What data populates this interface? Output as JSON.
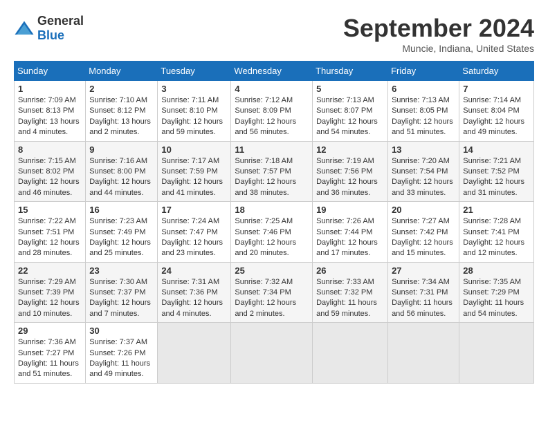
{
  "header": {
    "logo_general": "General",
    "logo_blue": "Blue",
    "title": "September 2024",
    "location": "Muncie, Indiana, United States"
  },
  "calendar": {
    "days_of_week": [
      "Sunday",
      "Monday",
      "Tuesday",
      "Wednesday",
      "Thursday",
      "Friday",
      "Saturday"
    ],
    "weeks": [
      [
        {
          "day": "1",
          "sunrise": "7:09 AM",
          "sunset": "8:13 PM",
          "daylight": "13 hours and 4 minutes."
        },
        {
          "day": "2",
          "sunrise": "7:10 AM",
          "sunset": "8:12 PM",
          "daylight": "13 hours and 2 minutes."
        },
        {
          "day": "3",
          "sunrise": "7:11 AM",
          "sunset": "8:10 PM",
          "daylight": "12 hours and 59 minutes."
        },
        {
          "day": "4",
          "sunrise": "7:12 AM",
          "sunset": "8:09 PM",
          "daylight": "12 hours and 56 minutes."
        },
        {
          "day": "5",
          "sunrise": "7:13 AM",
          "sunset": "8:07 PM",
          "daylight": "12 hours and 54 minutes."
        },
        {
          "day": "6",
          "sunrise": "7:13 AM",
          "sunset": "8:05 PM",
          "daylight": "12 hours and 51 minutes."
        },
        {
          "day": "7",
          "sunrise": "7:14 AM",
          "sunset": "8:04 PM",
          "daylight": "12 hours and 49 minutes."
        }
      ],
      [
        {
          "day": "8",
          "sunrise": "7:15 AM",
          "sunset": "8:02 PM",
          "daylight": "12 hours and 46 minutes."
        },
        {
          "day": "9",
          "sunrise": "7:16 AM",
          "sunset": "8:00 PM",
          "daylight": "12 hours and 44 minutes."
        },
        {
          "day": "10",
          "sunrise": "7:17 AM",
          "sunset": "7:59 PM",
          "daylight": "12 hours and 41 minutes."
        },
        {
          "day": "11",
          "sunrise": "7:18 AM",
          "sunset": "7:57 PM",
          "daylight": "12 hours and 38 minutes."
        },
        {
          "day": "12",
          "sunrise": "7:19 AM",
          "sunset": "7:56 PM",
          "daylight": "12 hours and 36 minutes."
        },
        {
          "day": "13",
          "sunrise": "7:20 AM",
          "sunset": "7:54 PM",
          "daylight": "12 hours and 33 minutes."
        },
        {
          "day": "14",
          "sunrise": "7:21 AM",
          "sunset": "7:52 PM",
          "daylight": "12 hours and 31 minutes."
        }
      ],
      [
        {
          "day": "15",
          "sunrise": "7:22 AM",
          "sunset": "7:51 PM",
          "daylight": "12 hours and 28 minutes."
        },
        {
          "day": "16",
          "sunrise": "7:23 AM",
          "sunset": "7:49 PM",
          "daylight": "12 hours and 25 minutes."
        },
        {
          "day": "17",
          "sunrise": "7:24 AM",
          "sunset": "7:47 PM",
          "daylight": "12 hours and 23 minutes."
        },
        {
          "day": "18",
          "sunrise": "7:25 AM",
          "sunset": "7:46 PM",
          "daylight": "12 hours and 20 minutes."
        },
        {
          "day": "19",
          "sunrise": "7:26 AM",
          "sunset": "7:44 PM",
          "daylight": "12 hours and 17 minutes."
        },
        {
          "day": "20",
          "sunrise": "7:27 AM",
          "sunset": "7:42 PM",
          "daylight": "12 hours and 15 minutes."
        },
        {
          "day": "21",
          "sunrise": "7:28 AM",
          "sunset": "7:41 PM",
          "daylight": "12 hours and 12 minutes."
        }
      ],
      [
        {
          "day": "22",
          "sunrise": "7:29 AM",
          "sunset": "7:39 PM",
          "daylight": "12 hours and 10 minutes."
        },
        {
          "day": "23",
          "sunrise": "7:30 AM",
          "sunset": "7:37 PM",
          "daylight": "12 hours and 7 minutes."
        },
        {
          "day": "24",
          "sunrise": "7:31 AM",
          "sunset": "7:36 PM",
          "daylight": "12 hours and 4 minutes."
        },
        {
          "day": "25",
          "sunrise": "7:32 AM",
          "sunset": "7:34 PM",
          "daylight": "12 hours and 2 minutes."
        },
        {
          "day": "26",
          "sunrise": "7:33 AM",
          "sunset": "7:32 PM",
          "daylight": "11 hours and 59 minutes."
        },
        {
          "day": "27",
          "sunrise": "7:34 AM",
          "sunset": "7:31 PM",
          "daylight": "11 hours and 56 minutes."
        },
        {
          "day": "28",
          "sunrise": "7:35 AM",
          "sunset": "7:29 PM",
          "daylight": "11 hours and 54 minutes."
        }
      ],
      [
        {
          "day": "29",
          "sunrise": "7:36 AM",
          "sunset": "7:27 PM",
          "daylight": "11 hours and 51 minutes."
        },
        {
          "day": "30",
          "sunrise": "7:37 AM",
          "sunset": "7:26 PM",
          "daylight": "11 hours and 49 minutes."
        },
        null,
        null,
        null,
        null,
        null
      ]
    ]
  }
}
